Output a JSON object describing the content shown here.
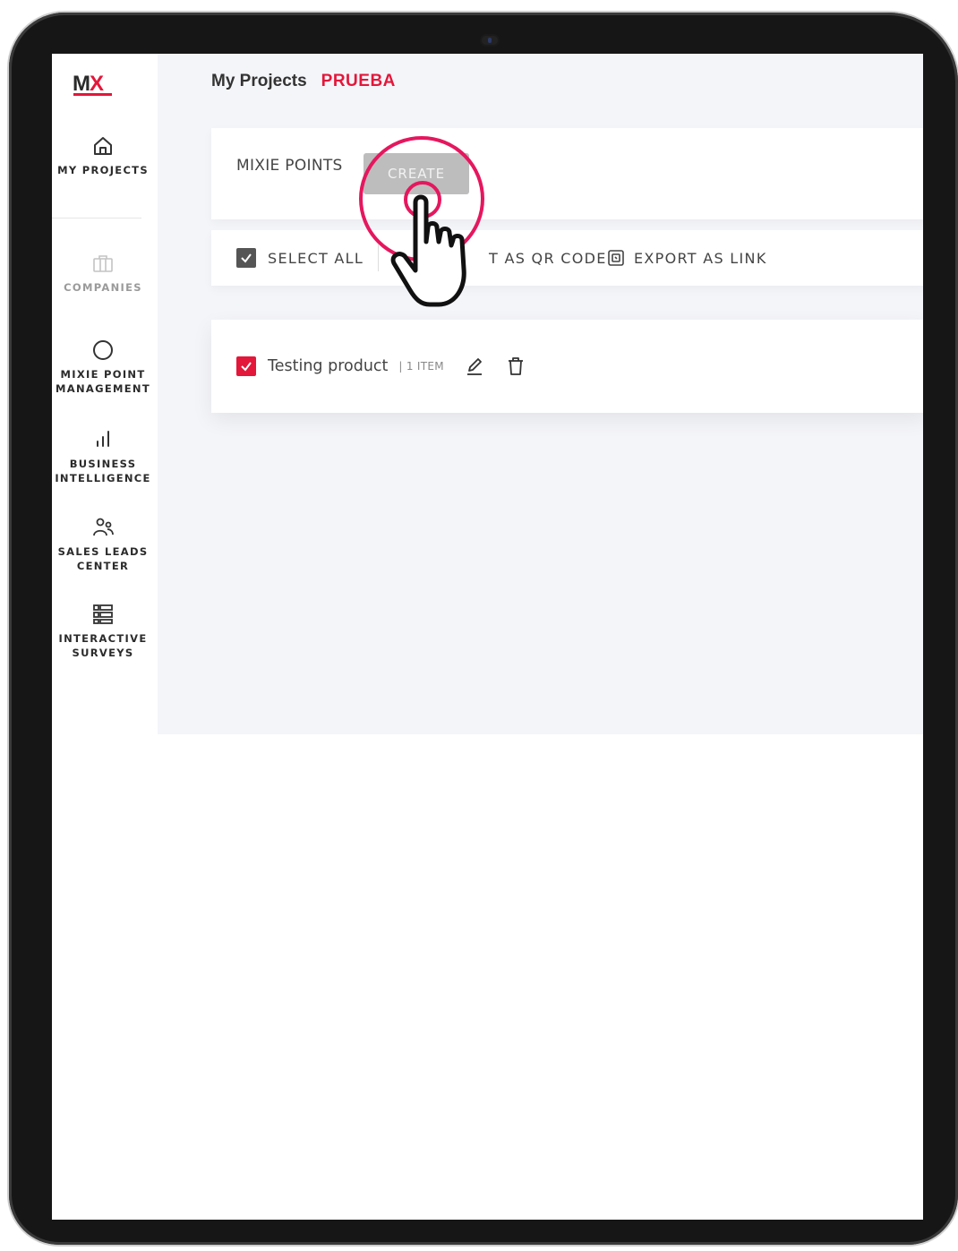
{
  "brand": {
    "logo_left": "M",
    "logo_right": "X",
    "accent": "#e3173a"
  },
  "breadcrumb": {
    "section": "My Projects",
    "project": "PRUEBA"
  },
  "sidebar": {
    "items": [
      {
        "label": "MY PROJECTS",
        "icon": "home-icon"
      },
      {
        "label": "COMPANIES",
        "icon": "briefcase-icon",
        "disabled": true
      },
      {
        "label": "MIXIE POINT MANAGEMENT",
        "icon": "circle-icon"
      },
      {
        "label": "BUSINESS INTELLIGENCE",
        "icon": "bar-chart-icon"
      },
      {
        "label": "SALES LEADS CENTER",
        "icon": "users-icon"
      },
      {
        "label": "INTERACTIVE SURVEYS",
        "icon": "list-grid-icon"
      }
    ]
  },
  "mixie_points": {
    "title": "MIXIE POINTS",
    "create_label": "CREATE"
  },
  "toolbar": {
    "select_all": "SELECT ALL",
    "export_qr": "T AS QR CODE",
    "export_link": "EXPORT AS LINK"
  },
  "items": [
    {
      "name": "Testing product",
      "count": "| 1 ITEM",
      "checked": true
    }
  ],
  "overlay": {
    "icon": "tap-hand-icon",
    "ring_color": "#e5175e"
  }
}
